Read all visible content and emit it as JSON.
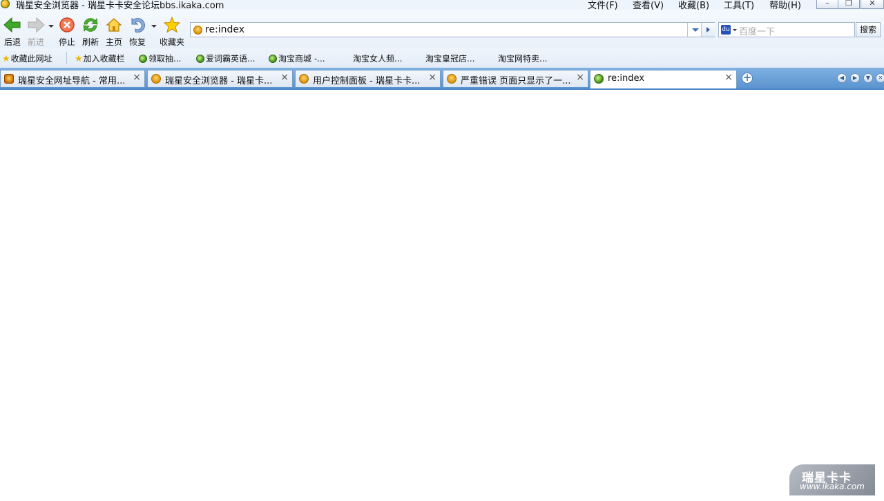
{
  "window": {
    "title": "瑞星安全浏览器 - 瑞星卡卡安全论坛bbs.ikaka.com",
    "menus": [
      "文件(F)",
      "查看(V)",
      "收藏(B)",
      "工具(T)",
      "帮助(H)"
    ],
    "controls": {
      "minimize": "–",
      "maximize": "❐",
      "close": "✕"
    }
  },
  "toolbar": {
    "back": "后退",
    "forward": "前进",
    "stop": "停止",
    "refresh": "刷新",
    "home": "主页",
    "restore": "恢复",
    "favorites": "收藏夹"
  },
  "address": {
    "value": "re:index"
  },
  "search": {
    "placeholder": "百度一下",
    "button": "搜索",
    "engine_glyph": "du"
  },
  "favbar": {
    "add_page": "收藏此网址",
    "add_bar": "加入收藏栏",
    "items": [
      "领取抽...",
      "爱词霸英语...",
      "淘宝商城 -...",
      "淘宝女人频...",
      "淘宝皇冠店...",
      "淘宝网特卖..."
    ]
  },
  "tabs": [
    {
      "title": "瑞星安全网址导航 - 常用...",
      "icon": "lion-icon",
      "active": false
    },
    {
      "title": "瑞星安全浏览器 - 瑞星卡...",
      "icon": "rising-icon",
      "active": false
    },
    {
      "title": "用户控制面板 - 瑞星卡卡...",
      "icon": "rising-icon",
      "active": false
    },
    {
      "title": "严重错误 页面只显示了一...",
      "icon": "rising-icon",
      "active": false
    },
    {
      "title": "re:index",
      "icon": "ie-icon",
      "active": true
    }
  ],
  "tab_close_glyph": "×",
  "new_tab_glyph": "+",
  "watermark": {
    "brand": "瑞星卡卡",
    "url": "www.ikaka.com"
  }
}
